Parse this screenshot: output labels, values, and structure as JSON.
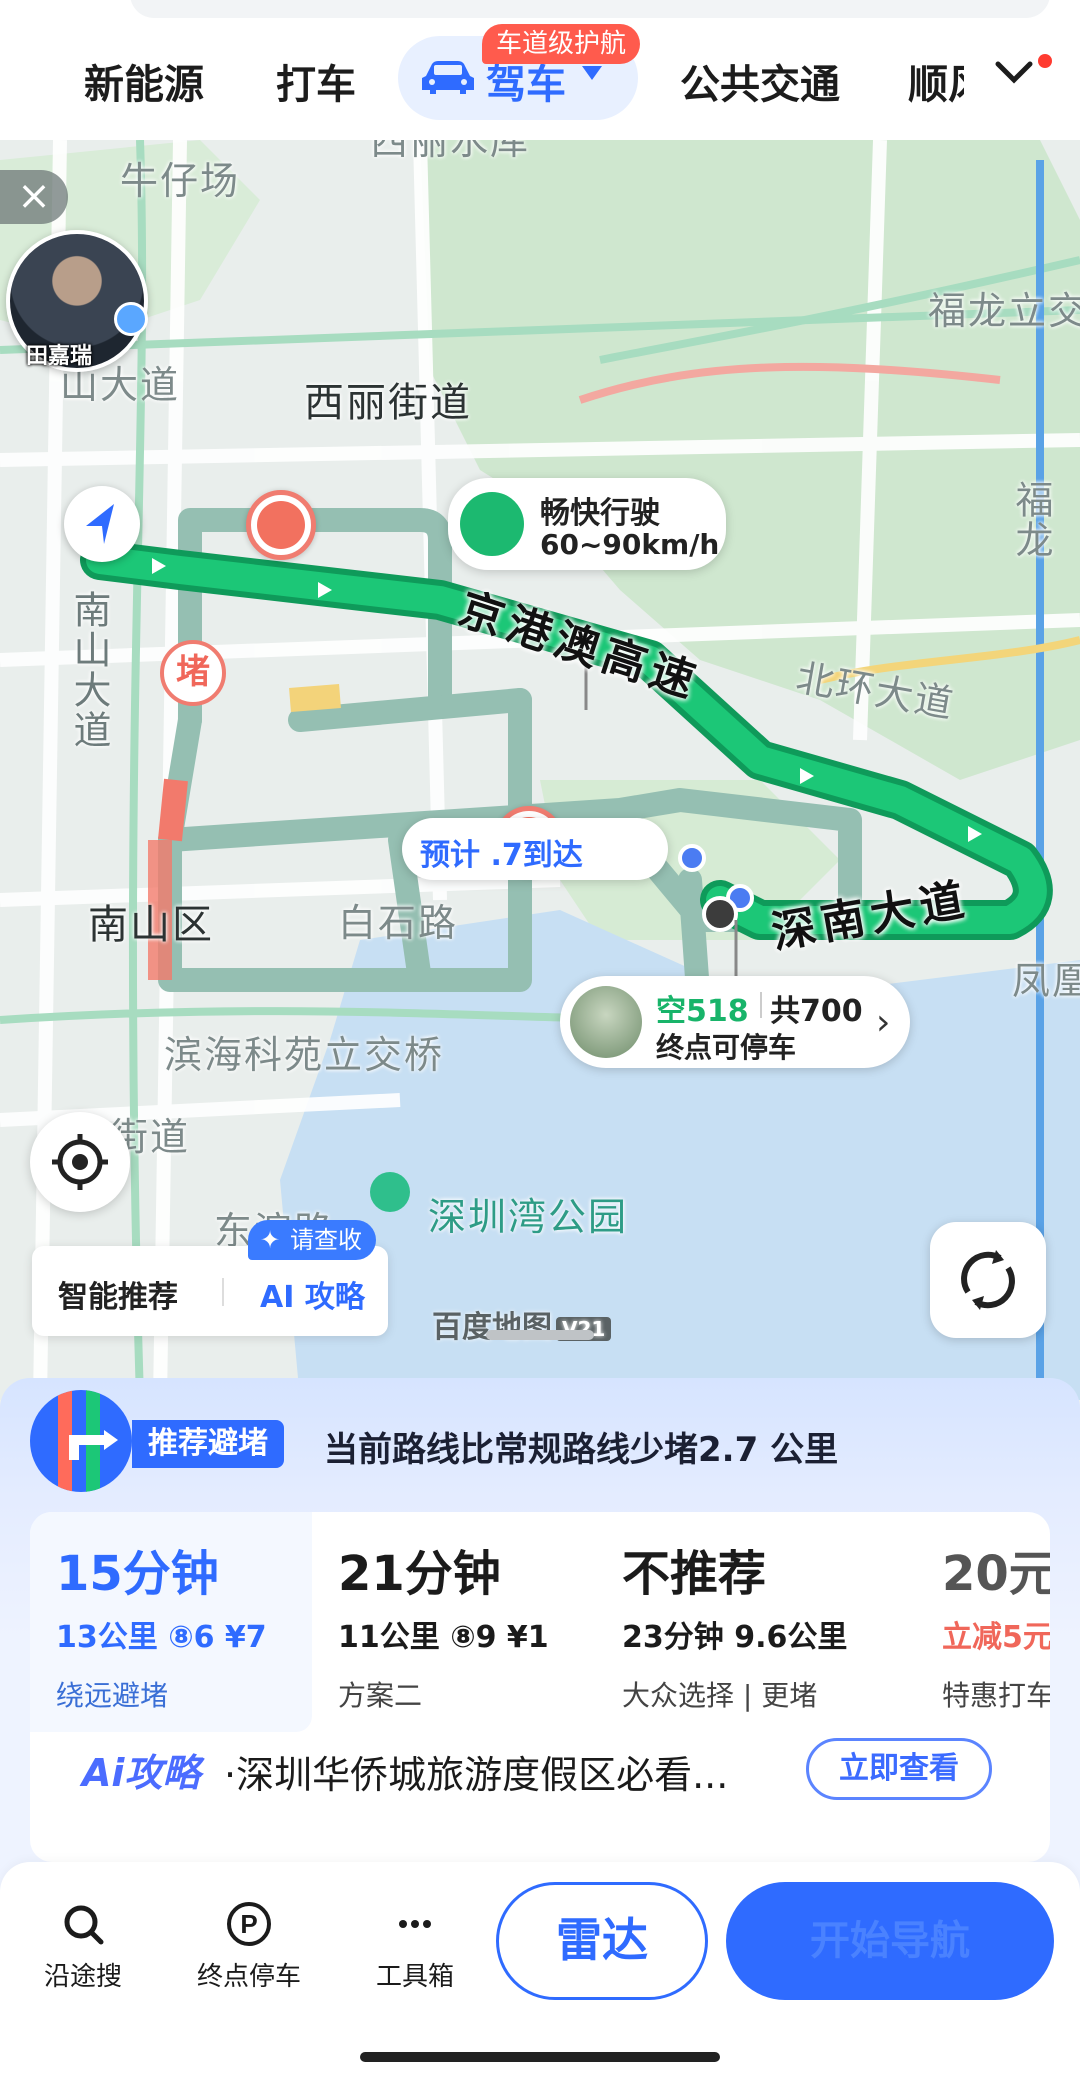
{
  "top_tabs": [
    "新能源",
    "打车",
    "驾车",
    "公共交通",
    "顺风"
  ],
  "lane_badge": "车道级护航",
  "avatar_name": "田嘉瑞",
  "map_labels": {
    "niuzaichang": "牛仔场",
    "xilishuiku": "西丽水库",
    "fulong": "福龙立交",
    "shahe": "西丽街道",
    "shanxian": "山大道",
    "nanshan_da": "南山大道",
    "nanshan_qu": "南山区",
    "baishi": "白石路",
    "binhai": "滨海科苑立交桥",
    "jiedao": "街道",
    "dongbin": "东滨路",
    "bay_park": "深圳湾公园",
    "beihuan": "北环大道",
    "fulong_v": "福龙",
    "fenghuang": "凤凰",
    "jinggang": "京港澳高速",
    "shennan": "深南大道"
  },
  "speed_callout": {
    "title": "畅快行驶",
    "range": "60~90km/h"
  },
  "jam_label": "堵",
  "eta": "预计 .7到达",
  "parking": {
    "free": "空518",
    "total": "共700",
    "note": "终点可停车"
  },
  "smart": {
    "recommend": "智能推荐",
    "ai": "AI 攻略",
    "badge": "请查收"
  },
  "watermark": {
    "name": "百度地图",
    "version": "V21"
  },
  "avoid": {
    "tag": "推荐避堵",
    "text": "当前路线比常规路线少堵2.7 公里"
  },
  "routes": [
    {
      "time": "15分钟",
      "meta": "13公里  ⑧6  ¥7",
      "tag": "绕远避堵"
    },
    {
      "time": "21分钟",
      "meta": "11公里  ⑧9  ¥1",
      "tag": "方案二"
    },
    {
      "time": "不推荐",
      "meta": "23分钟 9.6公里",
      "tag": "大众选择 | 更堵"
    },
    {
      "time": "20元",
      "meta": "立减5元",
      "tag": "特惠打车"
    }
  ],
  "ai_row": {
    "logo": "Ai攻略",
    "text": "·深圳华侨城旅游度假区必看...",
    "button": "立即查看"
  },
  "tools": [
    "沿途搜",
    "终点停车",
    "工具箱"
  ],
  "radar": "雷达",
  "start": "开始导航",
  "colors": {
    "accent": "#2f6bff",
    "route_green": "#1cb970",
    "route_alt": "#9fc4b8",
    "jam_red": "#f0675a"
  }
}
